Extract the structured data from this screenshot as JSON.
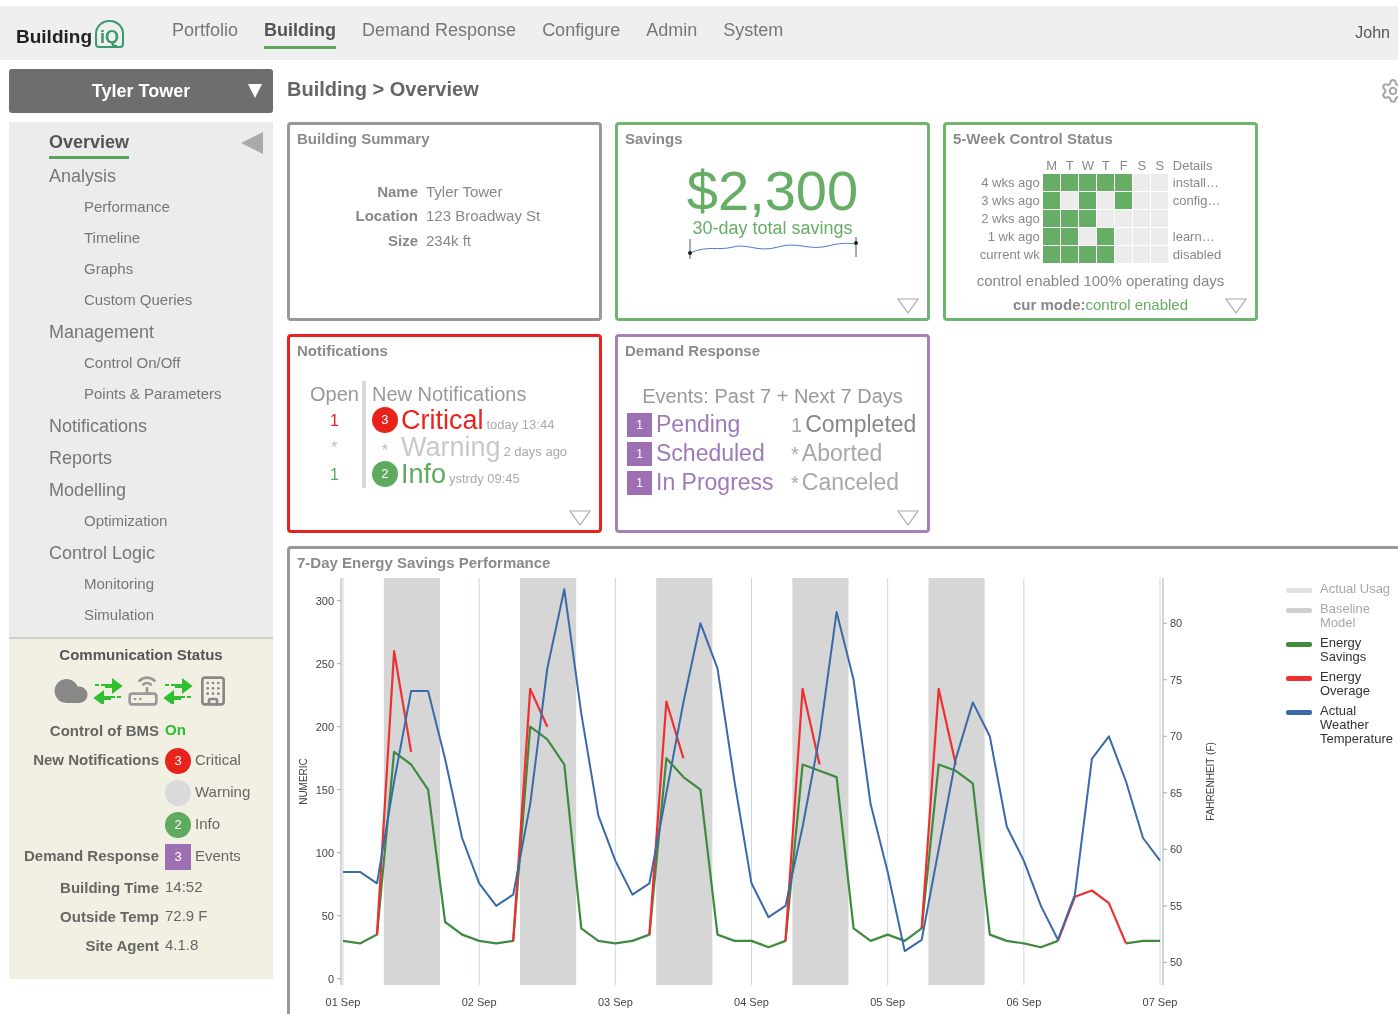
{
  "nav": {
    "logo": {
      "text": "Building",
      "mark": "iQ"
    },
    "items": [
      {
        "label": "Portfolio",
        "selected": false
      },
      {
        "label": "Building",
        "selected": true
      },
      {
        "label": "Demand Response",
        "selected": false
      },
      {
        "label": "Configure",
        "selected": false
      },
      {
        "label": "Admin",
        "selected": false
      },
      {
        "label": "System",
        "selected": false
      }
    ],
    "user": "John"
  },
  "sidebar": {
    "building": "Tyler Tower",
    "menu": [
      {
        "label": "Overview",
        "selected": true
      },
      {
        "label": "Analysis",
        "selected": false,
        "children": [
          {
            "label": "Performance",
            "selected": false
          },
          {
            "label": "Timeline",
            "selected": false
          },
          {
            "label": "Graphs",
            "selected": false
          },
          {
            "label": "Custom Queries",
            "selected": false
          }
        ]
      },
      {
        "label": "Management",
        "selected": false,
        "children": [
          {
            "label": "Control On/Off",
            "selected": false
          },
          {
            "label": "Points & Parameters",
            "selected": false
          }
        ]
      },
      {
        "label": "Notifications",
        "selected": false
      },
      {
        "label": "Reports",
        "selected": false
      },
      {
        "label": "Modelling",
        "selected": false,
        "children": [
          {
            "label": "Optimization",
            "selected": false
          }
        ]
      },
      {
        "label": "Control Logic",
        "selected": false,
        "children": [
          {
            "label": "Monitoring",
            "selected": false
          },
          {
            "label": "Simulation",
            "selected": false
          }
        ]
      }
    ],
    "comm": {
      "title": "Communication Status",
      "bms": {
        "label": "Control of BMS",
        "value": "On"
      },
      "notifications": {
        "label": "New Notifications",
        "items": [
          {
            "kind": "critical",
            "count": "3",
            "label": "Critical"
          },
          {
            "kind": "warning",
            "label": "Warning"
          },
          {
            "kind": "info",
            "count": "2",
            "label": "Info"
          }
        ]
      },
      "demand": {
        "label": "Demand Response",
        "count": "3",
        "value": "Events"
      },
      "facts": [
        {
          "label": "Building Time",
          "value": "14:52"
        },
        {
          "label": "Outside Temp",
          "value": "72.9 F"
        },
        {
          "label": "Site Agent",
          "value": "4.1.8"
        }
      ]
    }
  },
  "breadcrumb": "Building > Overview",
  "summary": {
    "title": "Building Summary",
    "fields": [
      {
        "label": "Name",
        "value": "Tyler Tower"
      },
      {
        "label": "Location",
        "value": "123 Broadway St"
      },
      {
        "label": "Size",
        "value": "234k ft"
      }
    ]
  },
  "savings": {
    "title": "Savings",
    "amount": "$2,300",
    "caption": "30-day total savings"
  },
  "control_status": {
    "title": "5-Week Control Status",
    "days": [
      "M",
      "T",
      "W",
      "T",
      "F",
      "S",
      "S"
    ],
    "details_heading": "Details",
    "weeks": [
      {
        "label": "4 wks ago",
        "days": [
          true,
          true,
          true,
          true,
          true,
          false,
          false
        ],
        "detail": "install…"
      },
      {
        "label": "3 wks ago",
        "days": [
          true,
          false,
          true,
          false,
          true,
          false,
          false
        ],
        "detail": "config…"
      },
      {
        "label": "2 wks ago",
        "days": [
          true,
          true,
          true,
          false,
          false,
          false,
          false
        ]
      },
      {
        "label": "1 wk ago",
        "days": [
          true,
          true,
          false,
          true,
          false,
          false,
          false
        ],
        "detail": "learn…"
      },
      {
        "label": "current wk",
        "days": [
          true,
          true,
          true,
          true,
          false,
          false,
          false
        ],
        "detail": "disabled"
      }
    ],
    "summary": "control enabled 100% operating days",
    "mode_label": "cur mode:",
    "mode": "control enabled"
  },
  "notifications": {
    "title": "Notifications",
    "open_heading": "Open",
    "new_heading": "New Notifications",
    "rows": [
      {
        "kind": "critical",
        "open": "1",
        "count": "3",
        "label": "Critical",
        "time": "today 13:44"
      },
      {
        "kind": "warning",
        "open": "*",
        "count": "*",
        "label": "Warning",
        "time": "2 days ago"
      },
      {
        "kind": "info",
        "open": "1",
        "count": "2",
        "label": "Info",
        "time": "ystrdy 09:45"
      }
    ]
  },
  "demand_response": {
    "title": "Demand Response",
    "heading": "Events: Past 7 + Next 7 Days",
    "active": [
      {
        "count": "1",
        "label": "Pending"
      },
      {
        "count": "1",
        "label": "Scheduled"
      },
      {
        "count": "1",
        "label": "In Progress"
      }
    ],
    "closed": [
      {
        "count": "1",
        "label": "Completed",
        "muted": false
      },
      {
        "count": "*",
        "label": "Aborted",
        "muted": true
      },
      {
        "count": "*",
        "label": "Canceled",
        "muted": true
      }
    ]
  },
  "chart": {
    "title": "7-Day Energy Savings Performance",
    "hidden_legend": [
      {
        "label": "Actual Usag",
        "color": "#e0e0e0",
        "active": false
      },
      {
        "label": "Baseline Model",
        "color": "#cfcfcf",
        "active": false
      }
    ],
    "chart_data": {
      "type": "line",
      "grid": true,
      "ylabel": "NUMERIC",
      "y2label": "FAHRENHEIT (F)",
      "ylim": [
        -5,
        318
      ],
      "y2lim": [
        48,
        84
      ],
      "categories": [
        "01 Sep",
        null,
        null,
        null,
        null,
        null,
        null,
        null,
        "02 Sep",
        null,
        null,
        null,
        null,
        null,
        null,
        null,
        "03 Sep",
        null,
        null,
        null,
        null,
        null,
        null,
        null,
        "04 Sep",
        null,
        null,
        null,
        null,
        null,
        null,
        null,
        "05 Sep",
        null,
        null,
        null,
        null,
        null,
        null,
        null,
        "06 Sep",
        null,
        null,
        null,
        null,
        null,
        null,
        null,
        "07 Sep"
      ],
      "yticks": [
        0,
        50,
        100,
        150,
        200,
        250,
        300
      ],
      "y2ticks": [
        50,
        55,
        60,
        65,
        70,
        75,
        80
      ],
      "series": [
        {
          "name": "Energy Savings",
          "color": "#3f8a3f",
          "values": [
            30,
            28,
            35,
            180,
            170,
            150,
            45,
            35,
            30,
            28,
            30,
            200,
            190,
            170,
            40,
            30,
            28,
            30,
            35,
            175,
            160,
            150,
            35,
            30,
            30,
            25,
            30,
            170,
            165,
            160,
            40,
            30,
            35,
            30,
            40,
            170,
            165,
            155,
            35,
            30,
            28,
            25,
            30,
            null,
            null,
            null,
            28,
            30,
            30
          ]
        },
        {
          "name": "Energy Overage",
          "color": "#ee3030",
          "values": [
            null,
            null,
            35,
            260,
            180,
            null,
            null,
            null,
            null,
            null,
            30,
            230,
            200,
            null,
            null,
            null,
            null,
            null,
            35,
            220,
            175,
            null,
            null,
            null,
            null,
            null,
            30,
            230,
            170,
            null,
            null,
            null,
            null,
            null,
            40,
            230,
            170,
            null,
            null,
            null,
            null,
            null,
            30,
            65,
            70,
            60,
            28,
            null,
            null
          ]
        },
        {
          "name": "Actual Weather Temperature",
          "color": "#3b6aa8",
          "axis": "y2",
          "values": [
            58,
            58,
            57,
            66,
            74,
            74,
            68,
            61,
            57,
            55,
            56,
            64,
            76,
            83,
            72,
            63,
            59,
            56,
            57,
            65,
            73,
            80,
            76,
            66,
            57,
            54,
            55,
            62,
            70,
            81,
            75,
            64,
            58,
            51,
            52,
            60,
            68,
            73,
            70,
            62,
            59,
            55,
            52,
            56,
            68,
            70,
            66,
            61,
            59
          ]
        }
      ]
    }
  }
}
